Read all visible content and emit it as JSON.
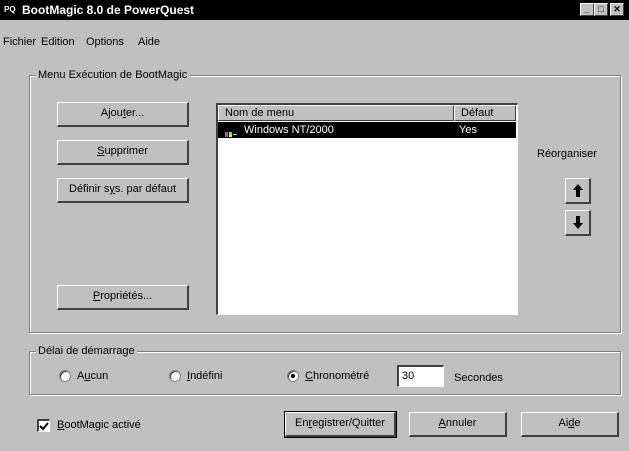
{
  "window": {
    "app_icon": "PQ",
    "title": "BootMagic 8.0 de PowerQuest",
    "controls": [
      "minimize-icon",
      "maximize-icon",
      "close-icon"
    ]
  },
  "menubar": {
    "items": [
      "Fichier",
      "Edition",
      "Options",
      "Aide"
    ]
  },
  "menu_group": {
    "title": "Menu Exécution de BootMagic",
    "buttons": {
      "add_pre": "Ajou",
      "add_key": "t",
      "add_post": "er...",
      "delete_key": "S",
      "delete_post": "upprimer",
      "default_pre": "Définir s",
      "default_key": "y",
      "default_post": "s. par défaut",
      "props_key": "P",
      "props_post": "ropriétés..."
    },
    "list": {
      "columns": [
        "Nom de menu",
        "Défaut"
      ],
      "rows": [
        {
          "name": "Windows NT/2000",
          "default": "Yes",
          "icon": "windows-logo-icon",
          "selected": true
        }
      ]
    },
    "reorder": {
      "label": "Réorganiser",
      "up_icon": "arrow-up-icon",
      "down_icon": "arrow-down-icon"
    }
  },
  "delay_group": {
    "title": "Délai de démarrage",
    "options": {
      "none_pre": "A",
      "none_key": "u",
      "none_post": "cun",
      "undef_key": "I",
      "undef_post": "ndéfini",
      "timed_key": "C",
      "timed_post": "hronométré"
    },
    "selected": "Chronométré",
    "seconds_value": "30",
    "seconds_label": "Secondes"
  },
  "footer": {
    "enabled_key": "B",
    "enabled_post": "ootMagic activé",
    "enabled_checked": true,
    "save_pre": "En",
    "save_key": "r",
    "save_post": "egistrer/Quitter",
    "cancel_key": "A",
    "cancel_post": "nnuler",
    "help_pre": "Ai",
    "help_key": "d",
    "help_post": "e"
  }
}
